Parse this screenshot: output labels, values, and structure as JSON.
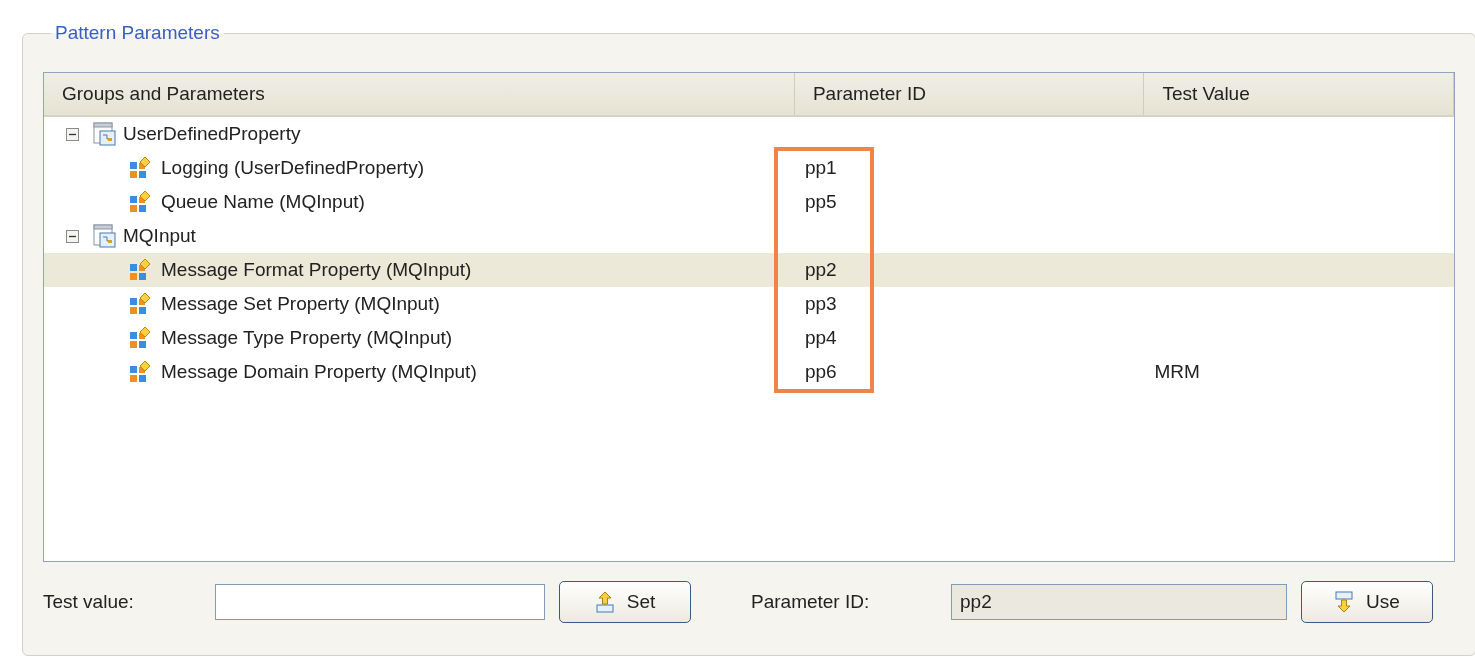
{
  "group_title": "Pattern Parameters",
  "columns": [
    {
      "label": "Groups and Parameters",
      "highlighted": false
    },
    {
      "label": "Parameter ID",
      "highlighted": true
    },
    {
      "label": "Test Value",
      "highlighted": false
    }
  ],
  "tree": [
    {
      "label": "UserDefinedProperty",
      "expanded": true,
      "selected": false,
      "children": [
        {
          "label": "Logging (UserDefinedProperty)",
          "param_id": "pp1",
          "selected": false
        },
        {
          "label": "Queue Name (MQInput)",
          "param_id": "pp5",
          "selected": false
        }
      ]
    },
    {
      "label": "MQInput",
      "expanded": true,
      "selected": false,
      "children": [
        {
          "label": "Message Format Property (MQInput)",
          "param_id": "pp2",
          "selected": true
        },
        {
          "label": "Message Set Property (MQInput)",
          "param_id": "pp3",
          "selected": false
        },
        {
          "label": "Message Type Property (MQInput)",
          "param_id": "pp4",
          "selected": false
        },
        {
          "label": "Message Domain Property (MQInput)",
          "param_id": "pp6",
          "test_value": "MRM",
          "selected": false
        }
      ]
    }
  ],
  "test_value": {
    "label": "Test value:"
  },
  "set_button": "Set",
  "parameter_id": {
    "label": "Parameter ID:",
    "value": "pp2",
    "disabled": true
  },
  "use_button": "Use"
}
